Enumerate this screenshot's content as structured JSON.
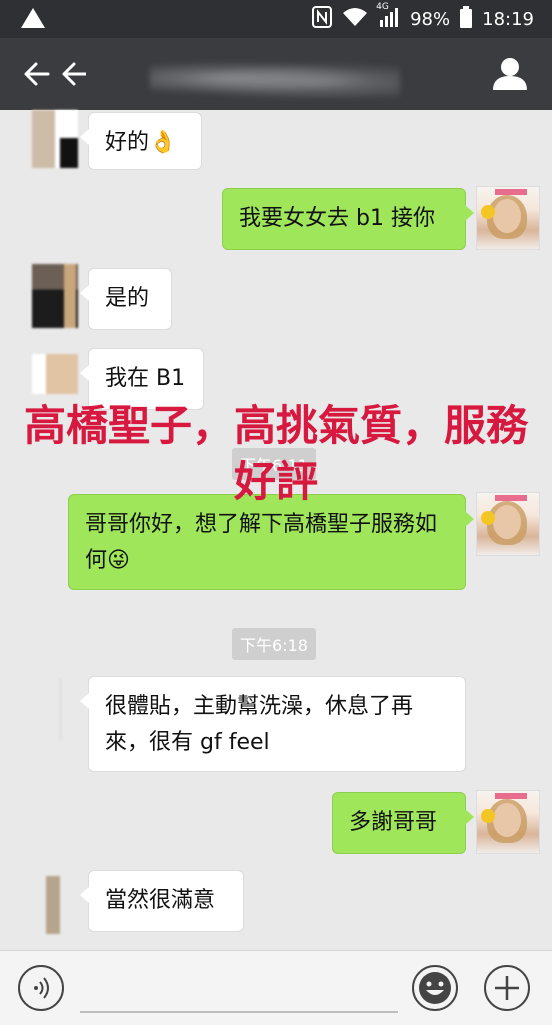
{
  "status_bar": {
    "battery": "98%",
    "time": "18:19",
    "network_label": "4G"
  },
  "header": {
    "title": ""
  },
  "messages": [
    {
      "side": "left",
      "text": "好的👌"
    },
    {
      "side": "right",
      "text": "我要女女去 b1 接你"
    },
    {
      "side": "left",
      "text": "是的"
    },
    {
      "side": "left",
      "text": "我在 B1"
    },
    {
      "side": "right",
      "text": "哥哥你好，想了解下高橋聖子服務如何😜"
    },
    {
      "side": "left",
      "text": "很體貼，主動幫洗澡，休息了再來，很有 gf feel"
    },
    {
      "side": "right",
      "text": "多謝哥哥"
    },
    {
      "side": "left",
      "text": "當然很滿意"
    }
  ],
  "timestamps": [
    "下午6:11",
    "下午6:18"
  ],
  "overlay": {
    "line1": "高橋聖子，高挑氣質，服務",
    "line2": "好評"
  },
  "colors": {
    "header_bg": "#3a3c40",
    "chat_bg": "#e9e9e9",
    "my_bubble": "#9fe65a",
    "overlay_text": "#d7183f"
  }
}
